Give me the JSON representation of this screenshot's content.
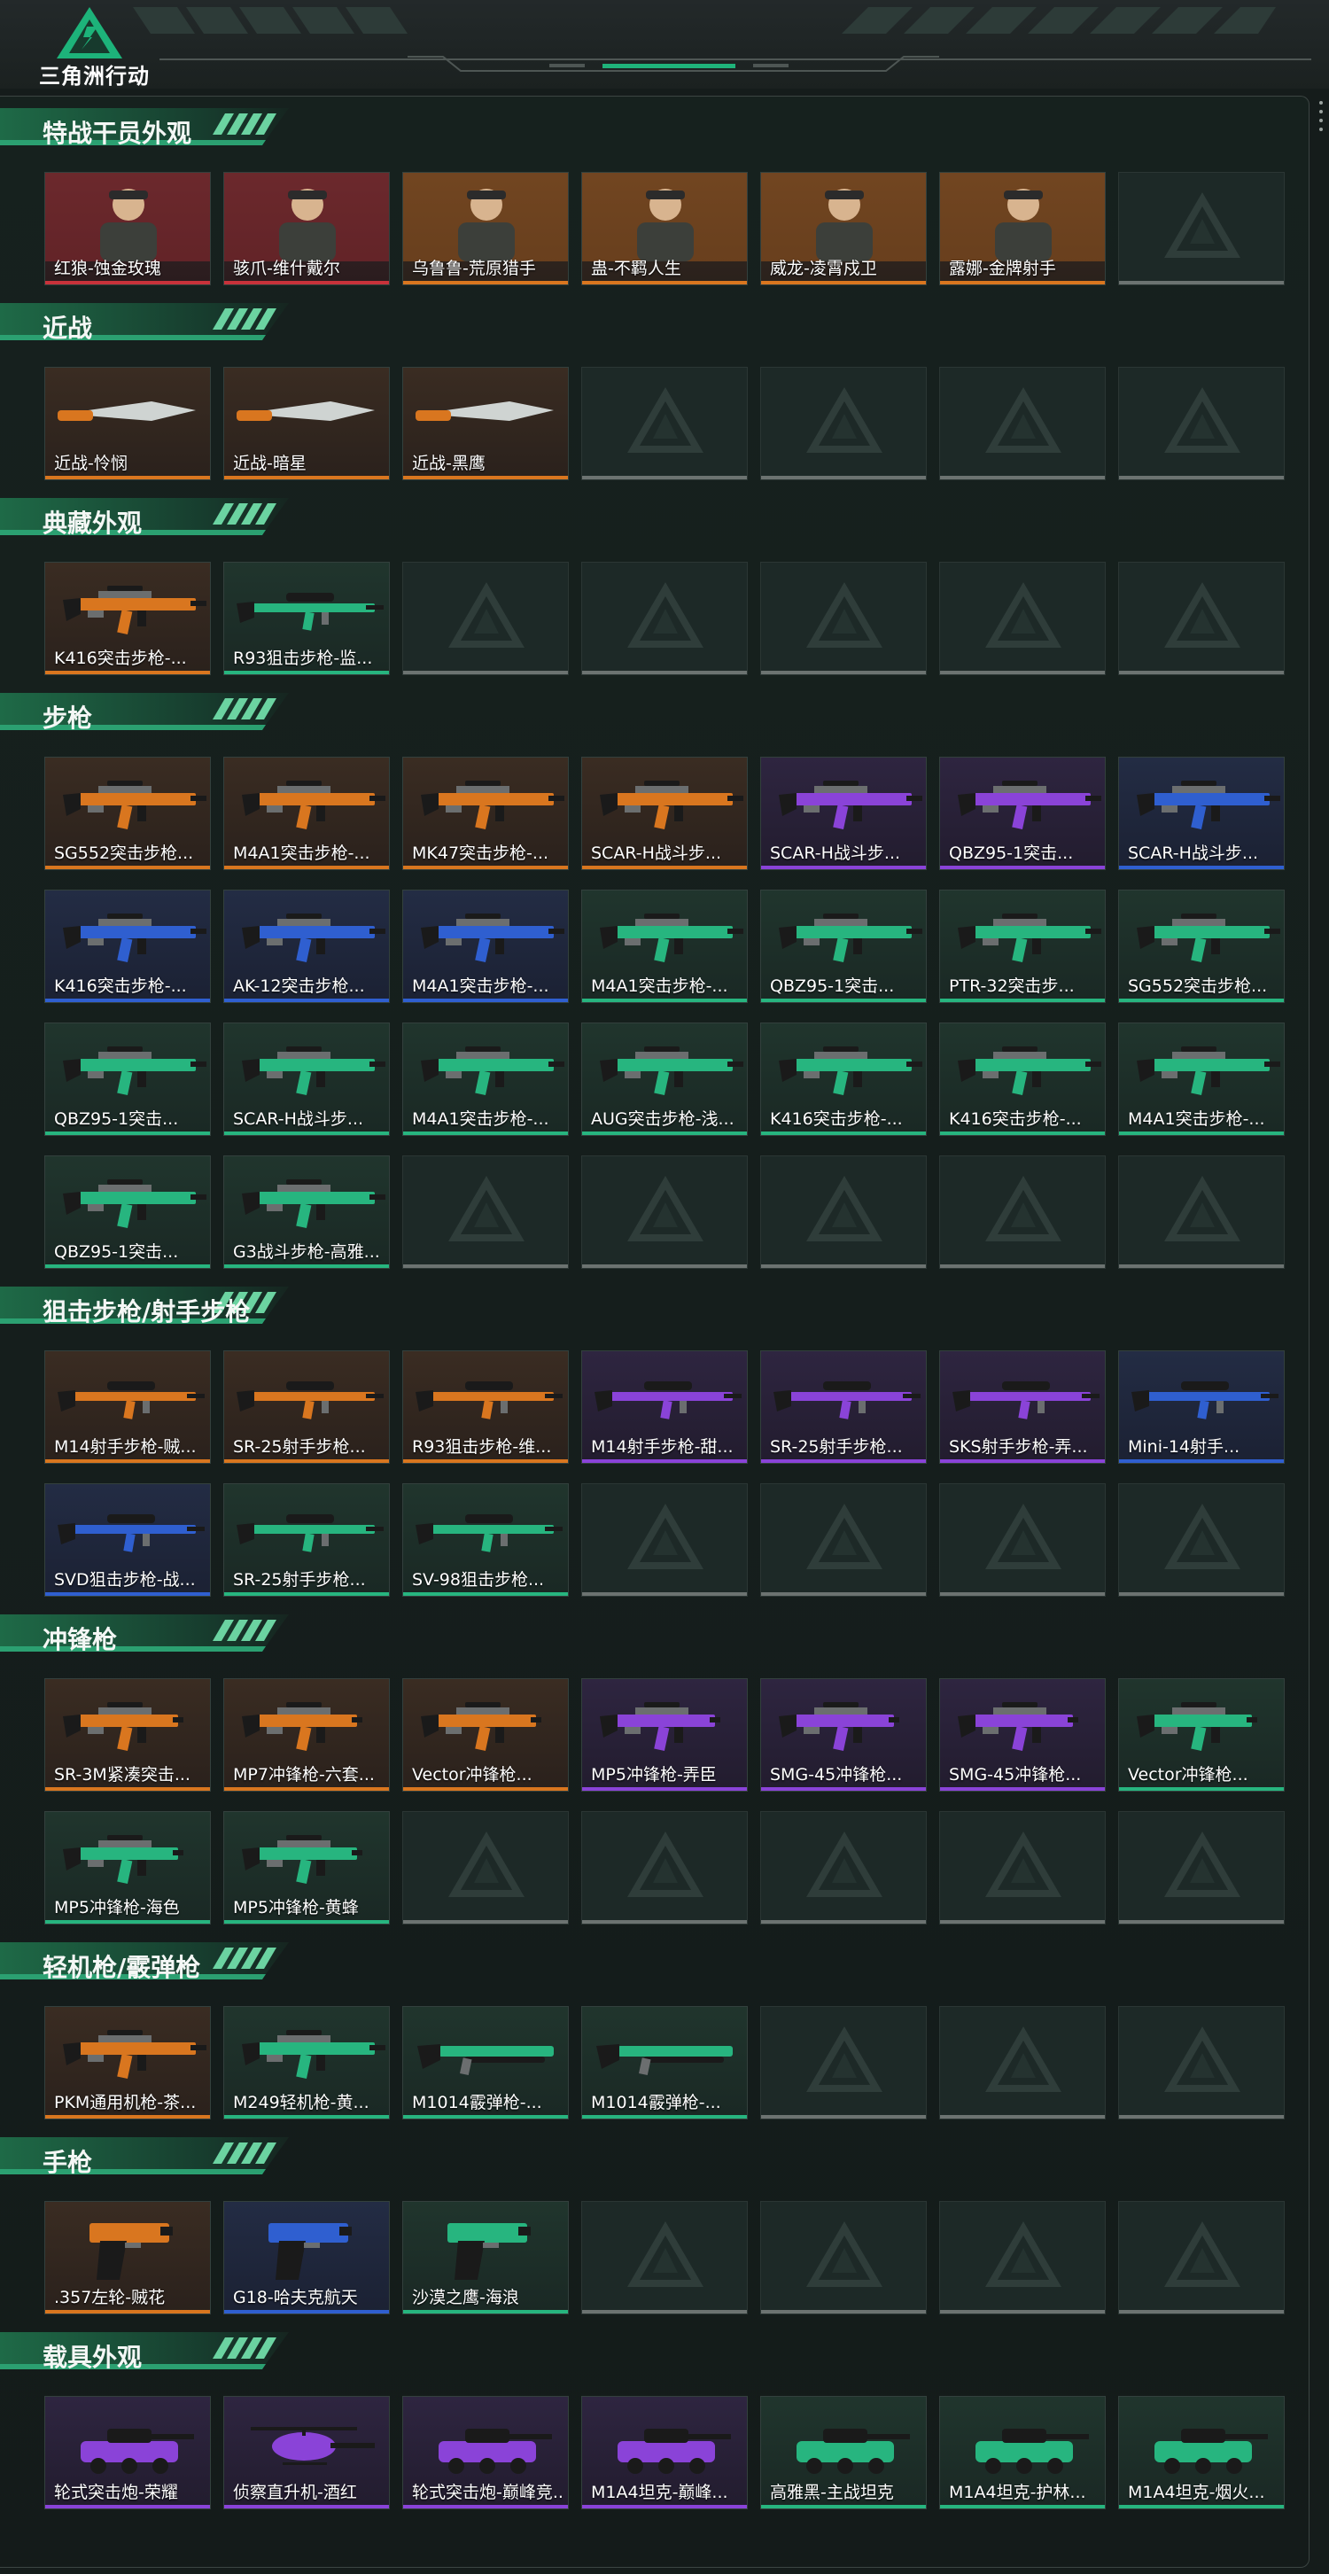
{
  "app": {
    "title": "三角洲行动"
  },
  "colors": {
    "accent": "#1fb37a",
    "rarity": {
      "orange": "#d9761f",
      "red": "#c8323a",
      "purple": "#8a43d8",
      "blue": "#2f5fd0",
      "green": "#27b57f",
      "gray": "#6c7371"
    }
  },
  "sections": [
    {
      "title": "特战干员外观",
      "rows": 1,
      "items": [
        {
          "name": "红狼-蚀金玫瑰",
          "rarity": "red",
          "icon": "operator-portrait"
        },
        {
          "name": "骇爪-维什戴尔",
          "rarity": "red",
          "icon": "operator-portrait"
        },
        {
          "name": "乌鲁鲁-荒原猎手",
          "rarity": "orange",
          "icon": "operator-portrait"
        },
        {
          "name": "蛊-不羁人生",
          "rarity": "orange",
          "icon": "operator-portrait"
        },
        {
          "name": "威龙-凌霄戍卫",
          "rarity": "orange",
          "icon": "operator-portrait"
        },
        {
          "name": "露娜-金牌射手",
          "rarity": "orange",
          "icon": "operator-portrait"
        }
      ]
    },
    {
      "title": "近战",
      "rows": 1,
      "items": [
        {
          "name": "近战-怜悯",
          "rarity": "orange",
          "icon": "knife"
        },
        {
          "name": "近战-暗星",
          "rarity": "orange",
          "icon": "knife"
        },
        {
          "name": "近战-黑鹰",
          "rarity": "orange",
          "icon": "knife"
        }
      ]
    },
    {
      "title": "典藏外观",
      "rows": 1,
      "items": [
        {
          "name": "K416突击步枪-...",
          "rarity": "orange",
          "icon": "rifle"
        },
        {
          "name": "R93狙击步枪-监...",
          "rarity": "green",
          "icon": "sniper"
        }
      ]
    },
    {
      "title": "步枪",
      "rows": 4,
      "items": [
        {
          "name": "SG552突击步枪...",
          "rarity": "orange",
          "icon": "rifle"
        },
        {
          "name": "M4A1突击步枪-...",
          "rarity": "orange",
          "icon": "rifle"
        },
        {
          "name": "MK47突击步枪-...",
          "rarity": "orange",
          "icon": "rifle"
        },
        {
          "name": "SCAR-H战斗步...",
          "rarity": "orange",
          "icon": "rifle"
        },
        {
          "name": "SCAR-H战斗步...",
          "rarity": "purple",
          "icon": "rifle"
        },
        {
          "name": "QBZ95-1突击...",
          "rarity": "purple",
          "icon": "rifle"
        },
        {
          "name": "SCAR-H战斗步...",
          "rarity": "blue",
          "icon": "rifle"
        },
        {
          "name": "K416突击步枪-...",
          "rarity": "blue",
          "icon": "rifle"
        },
        {
          "name": "AK-12突击步枪...",
          "rarity": "blue",
          "icon": "rifle"
        },
        {
          "name": "M4A1突击步枪-...",
          "rarity": "blue",
          "icon": "rifle"
        },
        {
          "name": "M4A1突击步枪-...",
          "rarity": "green",
          "icon": "rifle"
        },
        {
          "name": "QBZ95-1突击...",
          "rarity": "green",
          "icon": "rifle"
        },
        {
          "name": "PTR-32突击步...",
          "rarity": "green",
          "icon": "rifle"
        },
        {
          "name": "SG552突击步枪...",
          "rarity": "green",
          "icon": "rifle"
        },
        {
          "name": "QBZ95-1突击...",
          "rarity": "green",
          "icon": "rifle"
        },
        {
          "name": "SCAR-H战斗步...",
          "rarity": "green",
          "icon": "rifle"
        },
        {
          "name": "M4A1突击步枪-...",
          "rarity": "green",
          "icon": "rifle"
        },
        {
          "name": "AUG突击步枪-浅...",
          "rarity": "green",
          "icon": "rifle"
        },
        {
          "name": "K416突击步枪-...",
          "rarity": "green",
          "icon": "rifle"
        },
        {
          "name": "K416突击步枪-...",
          "rarity": "green",
          "icon": "rifle"
        },
        {
          "name": "M4A1突击步枪-...",
          "rarity": "green",
          "icon": "rifle"
        },
        {
          "name": "QBZ95-1突击...",
          "rarity": "green",
          "icon": "rifle"
        },
        {
          "name": "G3战斗步枪-高雅...",
          "rarity": "green",
          "icon": "rifle"
        }
      ]
    },
    {
      "title": "狙击步枪/射手步枪",
      "rows": 2,
      "items": [
        {
          "name": "M14射手步枪-贼...",
          "rarity": "orange",
          "icon": "sniper"
        },
        {
          "name": "SR-25射手步枪...",
          "rarity": "orange",
          "icon": "sniper"
        },
        {
          "name": "R93狙击步枪-维...",
          "rarity": "orange",
          "icon": "sniper"
        },
        {
          "name": "M14射手步枪-甜...",
          "rarity": "purple",
          "icon": "sniper"
        },
        {
          "name": "SR-25射手步枪...",
          "rarity": "purple",
          "icon": "sniper"
        },
        {
          "name": "SKS射手步枪-弄...",
          "rarity": "purple",
          "icon": "sniper"
        },
        {
          "name": "Mini-14射手...",
          "rarity": "blue",
          "icon": "sniper"
        },
        {
          "name": "SVD狙击步枪-战...",
          "rarity": "blue",
          "icon": "sniper"
        },
        {
          "name": "SR-25射手步枪...",
          "rarity": "green",
          "icon": "sniper"
        },
        {
          "name": "SV-98狙击步枪...",
          "rarity": "green",
          "icon": "sniper"
        }
      ]
    },
    {
      "title": "冲锋枪",
      "rows": 2,
      "items": [
        {
          "name": "SR-3M紧凑突击...",
          "rarity": "orange",
          "icon": "smg"
        },
        {
          "name": "MP7冲锋枪-六套...",
          "rarity": "orange",
          "icon": "smg"
        },
        {
          "name": "Vector冲锋枪...",
          "rarity": "orange",
          "icon": "smg"
        },
        {
          "name": "MP5冲锋枪-弄臣",
          "rarity": "purple",
          "icon": "smg"
        },
        {
          "name": "SMG-45冲锋枪...",
          "rarity": "purple",
          "icon": "smg"
        },
        {
          "name": "SMG-45冲锋枪...",
          "rarity": "purple",
          "icon": "smg"
        },
        {
          "name": "Vector冲锋枪...",
          "rarity": "green",
          "icon": "smg"
        },
        {
          "name": "MP5冲锋枪-海色",
          "rarity": "green",
          "icon": "smg"
        },
        {
          "name": "MP5冲锋枪-黄蜂",
          "rarity": "green",
          "icon": "smg"
        }
      ]
    },
    {
      "title": "轻机枪/霰弹枪",
      "rows": 1,
      "items": [
        {
          "name": "PKM通用机枪-茶...",
          "rarity": "orange",
          "icon": "lmg"
        },
        {
          "name": "M249轻机枪-黄...",
          "rarity": "green",
          "icon": "lmg"
        },
        {
          "name": "M1014霰弹枪-...",
          "rarity": "green",
          "icon": "shotgun"
        },
        {
          "name": "M1014霰弹枪-...",
          "rarity": "green",
          "icon": "shotgun"
        }
      ]
    },
    {
      "title": "手枪",
      "rows": 1,
      "items": [
        {
          "name": ".357左轮-贼花",
          "rarity": "orange",
          "icon": "pistol"
        },
        {
          "name": "G18-哈夫克航天",
          "rarity": "blue",
          "icon": "pistol"
        },
        {
          "name": "沙漠之鹰-海浪",
          "rarity": "green",
          "icon": "pistol"
        }
      ]
    },
    {
      "title": "载具外观",
      "rows": 1,
      "items": [
        {
          "name": "轮式突击炮-荣耀",
          "rarity": "purple",
          "icon": "vehicle"
        },
        {
          "name": "侦察直升机-酒红",
          "rarity": "purple",
          "icon": "helicopter"
        },
        {
          "name": "轮式突击炮-巅峰竞...",
          "rarity": "purple",
          "icon": "vehicle"
        },
        {
          "name": "M1A4坦克-巅峰...",
          "rarity": "purple",
          "icon": "tank"
        },
        {
          "name": "高雅黑-主战坦克",
          "rarity": "green",
          "icon": "tank"
        },
        {
          "name": "M1A4坦克-护林...",
          "rarity": "green",
          "icon": "tank"
        },
        {
          "name": "M1A4坦克-烟火...",
          "rarity": "green",
          "icon": "tank"
        }
      ]
    }
  ]
}
